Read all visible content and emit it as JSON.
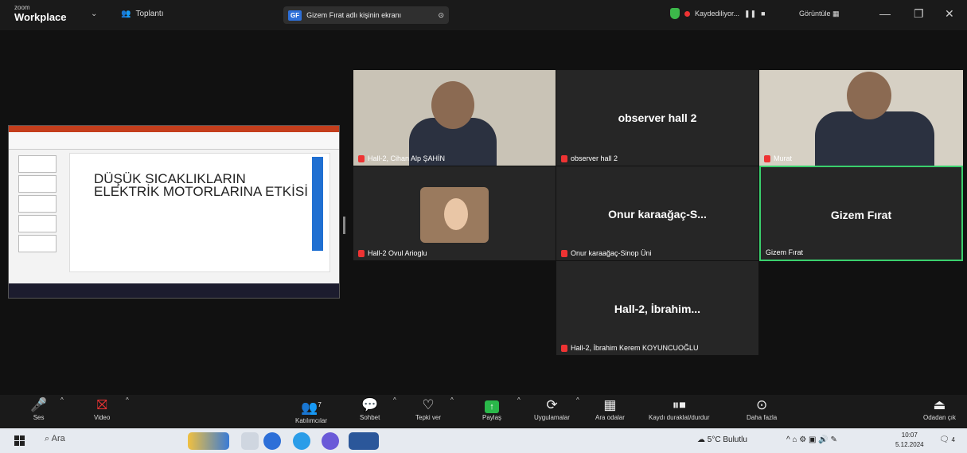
{
  "titlebar": {
    "brand_top": "zoom",
    "brand_name": "Workplace",
    "meeting_label": "Toplantı",
    "share_initials": "GF",
    "share_text": "Gizem Fırat adlı kişinin ekranı",
    "recording_text": "Kaydediliyor...",
    "view_label": "Görüntüle"
  },
  "slide": {
    "title": "DÜŞÜK SICAKLIKLARIN ELEKTRİK MOTORLARINA ETKİSİ"
  },
  "tiles": [
    {
      "name": "Hall-2, Cihan Alp ŞAHİN",
      "type": "video"
    },
    {
      "name": "observer hall 2",
      "display": "observer hall 2",
      "type": "text"
    },
    {
      "name": "Murat",
      "type": "video"
    },
    {
      "name": "Hall-2 Ovul Arioglu",
      "type": "avatar"
    },
    {
      "name": "Onur karaağaç-Sinop Üni",
      "display": "Onur karaağaç-S...",
      "type": "text"
    },
    {
      "name": "Gizem Fırat",
      "display": "Gizem Fırat",
      "type": "text",
      "active": true
    },
    {
      "name": "Hall-2, İbrahim Kerem KOYUNCUOĞLU",
      "display": "Hall-2, İbrahim...",
      "type": "text"
    }
  ],
  "toolbar": {
    "audio": "Ses",
    "video": "Video",
    "participants": "Katılımcılar",
    "participants_count": "7",
    "chat": "Sohbet",
    "react": "Tepki ver",
    "share": "Paylaş",
    "apps": "Uygulamalar",
    "breakout": "Ara odalar",
    "record": "Kaydı duraklat/durdur",
    "more": "Daha fazla",
    "leave": "Odadan çık"
  },
  "taskbar": {
    "search": "Ara",
    "weather": "5°C Bulutlu",
    "time": "10:07",
    "date": "5.12.2024",
    "notifications": "4"
  },
  "colors": {
    "accent_green": "#3ad06d",
    "record_red": "#e33333",
    "ppt_orange": "#c43e1c"
  }
}
